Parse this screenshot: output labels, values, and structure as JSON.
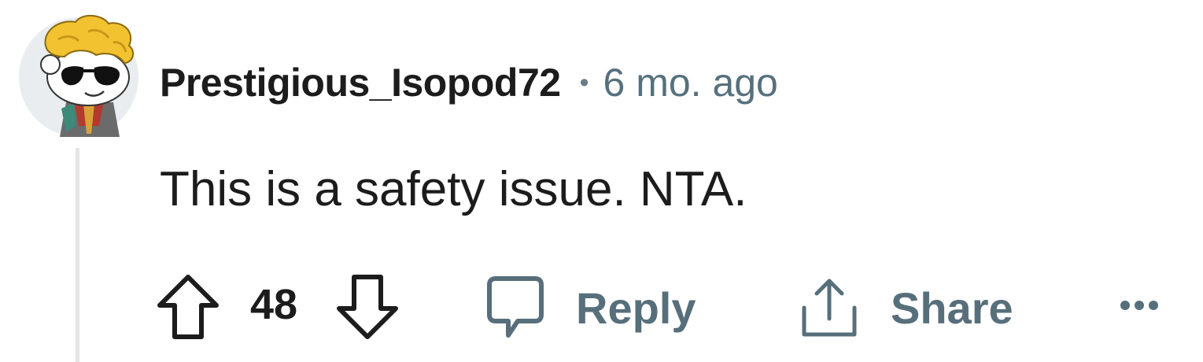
{
  "comment": {
    "username": "Prestigious_Isopod72",
    "separator": "•",
    "timestamp": "6 mo. ago",
    "text": "This is a safety issue. NTA.",
    "score": "48"
  },
  "actions": {
    "reply_label": "Reply",
    "share_label": "Share",
    "more_label": "•••"
  },
  "icons": {
    "upvote": "arrow-up-outline-icon",
    "downvote": "arrow-down-outline-icon",
    "reply": "speech-bubble-icon",
    "share": "share-upload-icon",
    "more": "ellipsis-icon"
  },
  "colors": {
    "text": "#1c1c1c",
    "muted": "#576f7b",
    "thread_line": "#e3e6e8",
    "avatar_bg": "#e9edef"
  }
}
